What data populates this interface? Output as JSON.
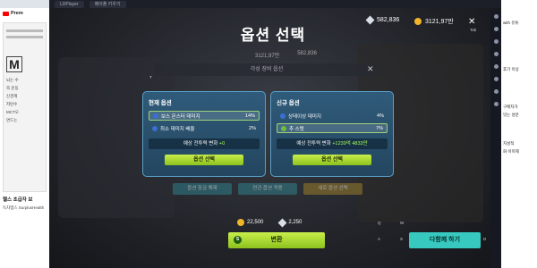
{
  "window": {
    "tabs": [
      "LDPlayer",
      "메이플 키우기"
    ]
  },
  "browser": {
    "logo_text": "Prem",
    "doc_big": "M",
    "doc_lines": [
      "뇌는 수",
      "즉 운동",
      "신경계",
      "저탄수",
      "MCT오",
      "면드는"
    ],
    "video_caption": "헬스 초급자 보",
    "channel": "득차엠스 SurplusHealth",
    "likes": "1.2만"
  },
  "sidebar_right": {
    "items": [
      "with 유튜",
      "후기 이상",
      "구매자가",
      "잇는 성분",
      "지성적",
      "화 이미제"
    ]
  },
  "game": {
    "title": "옵션 선택",
    "currency": {
      "gem": "582,836",
      "coin": "3121,97만"
    },
    "tab_label": "Tab",
    "small_vals": [
      "3121,97만",
      "582,836"
    ],
    "sub_title": "각성 장비 옵션",
    "left_panel": {
      "header": "현재 옵션",
      "rows": [
        {
          "name": "보스 몬스터 데미지",
          "value": "14%",
          "selected": true,
          "icon": "blue-dot"
        },
        {
          "name": "최소 데미지 배율",
          "value": "2%",
          "selected": false,
          "icon": "blue-dot"
        }
      ],
      "change_label": "예상 전투력 변화",
      "change_value": "+0",
      "button": "옵션 선택"
    },
    "right_panel": {
      "header": "신규 옵션",
      "rows": [
        {
          "name": "상태이상 데미지",
          "value": "4%",
          "selected": false,
          "icon": "blue-dot"
        },
        {
          "name": "추 스탯",
          "value": "7%",
          "selected": true,
          "icon": "green-dot"
        }
      ],
      "change_label": "예상 전투력 변화",
      "change_value": "+1239억 4833만",
      "button": "옵션 선택"
    },
    "bg_buttons": [
      "옵션 잠금 해제",
      "연관 옵션 적용",
      "새로 옵션 선택"
    ],
    "cost": {
      "coin": "22,500",
      "gem": "2,250"
    },
    "main_button": "변환",
    "together_button": "다함께 하기",
    "keys": [
      "Q",
      "W",
      "S",
      "A",
      "T",
      "D"
    ]
  },
  "colors": {
    "accent_green": "#a6ff5a",
    "panel_blue": "#2f5b7a",
    "button_green": "#8dc21e",
    "teal": "#37c9c0"
  }
}
